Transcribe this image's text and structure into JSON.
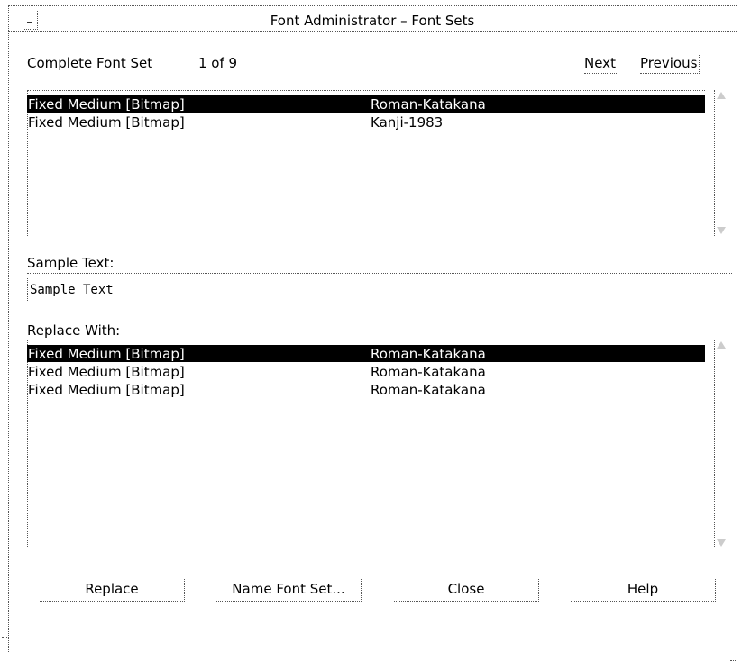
{
  "window": {
    "title": "Font Administrator – Font Sets"
  },
  "header": {
    "font_set_label": "Complete Font Set",
    "counter": "1 of 9",
    "next_label": "Next",
    "previous_label": "Previous"
  },
  "font_set_list": {
    "rows": [
      {
        "font": "Fixed Medium [Bitmap]",
        "charset": "Roman-Katakana",
        "selected": true
      },
      {
        "font": "Fixed Medium [Bitmap]",
        "charset": "Kanji-1983",
        "selected": false
      }
    ]
  },
  "sample": {
    "label": "Sample Text:",
    "value": "Sample Text"
  },
  "replace_list": {
    "label": "Replace With:",
    "rows": [
      {
        "font": "Fixed Medium [Bitmap]",
        "charset": "Roman-Katakana",
        "selected": true
      },
      {
        "font": "Fixed Medium [Bitmap]",
        "charset": "Roman-Katakana",
        "selected": false
      },
      {
        "font": "Fixed Medium [Bitmap]",
        "charset": "Roman-Katakana",
        "selected": false
      }
    ]
  },
  "buttons": {
    "replace": "Replace",
    "name_font_set": "Name Font Set...",
    "close": "Close",
    "help": "Help"
  },
  "icons": {
    "window_menu": "window-menu-icon",
    "scroll_up": "scroll-up-arrow-icon",
    "scroll_down": "scroll-down-arrow-icon"
  }
}
